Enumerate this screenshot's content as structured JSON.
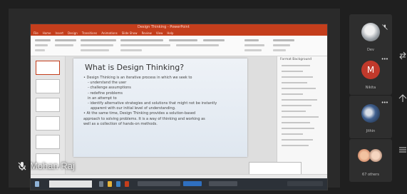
{
  "powerpoint": {
    "window_title": "Design Thinking - PowerPoint",
    "ribbon_tabs": [
      "File",
      "Home",
      "Insert",
      "Design",
      "Transitions",
      "Animations",
      "Slide Show",
      "Review",
      "View",
      "Help"
    ],
    "format_pane_title": "Format Background"
  },
  "slide": {
    "title": "What is Design Thinking?",
    "lines": [
      {
        "text": "• Design Thinking is an iterative process in which we seek to",
        "level": 0
      },
      {
        "text": "- understand the user",
        "level": 1
      },
      {
        "text": "- challenge assumptions",
        "level": 1
      },
      {
        "text": "- redefine problems",
        "level": 1
      },
      {
        "text": "in an attempt to",
        "level": 1
      },
      {
        "text": "- identify alternative strategies and solutions that might not be instantly",
        "level": 1
      },
      {
        "text": "apparent with our initial level of understanding.",
        "level": 2
      },
      {
        "text": "• At the same time, Design Thinking provides a solution-based",
        "level": 0
      },
      {
        "text": "approach to solving problems. It is a way of thinking and working as",
        "level": 0
      },
      {
        "text": "well as a collection of hands-on methods.",
        "level": 0
      }
    ]
  },
  "meeting": {
    "speaker_name": "Mohan Raj",
    "participants": [
      {
        "name": "Dev",
        "avatar": "photo",
        "muted": true
      },
      {
        "name": "Nikita",
        "avatar": "letter",
        "initial": "M",
        "color": "#c0392b"
      },
      {
        "name": "Jithin",
        "avatar": "photo"
      },
      {
        "name": "67 others",
        "avatar": "group"
      }
    ]
  },
  "colors": {
    "ppt_accent": "#c43e1c",
    "meeting_bg": "#1f1f1f",
    "tile_bg": "#2e2e2e"
  }
}
